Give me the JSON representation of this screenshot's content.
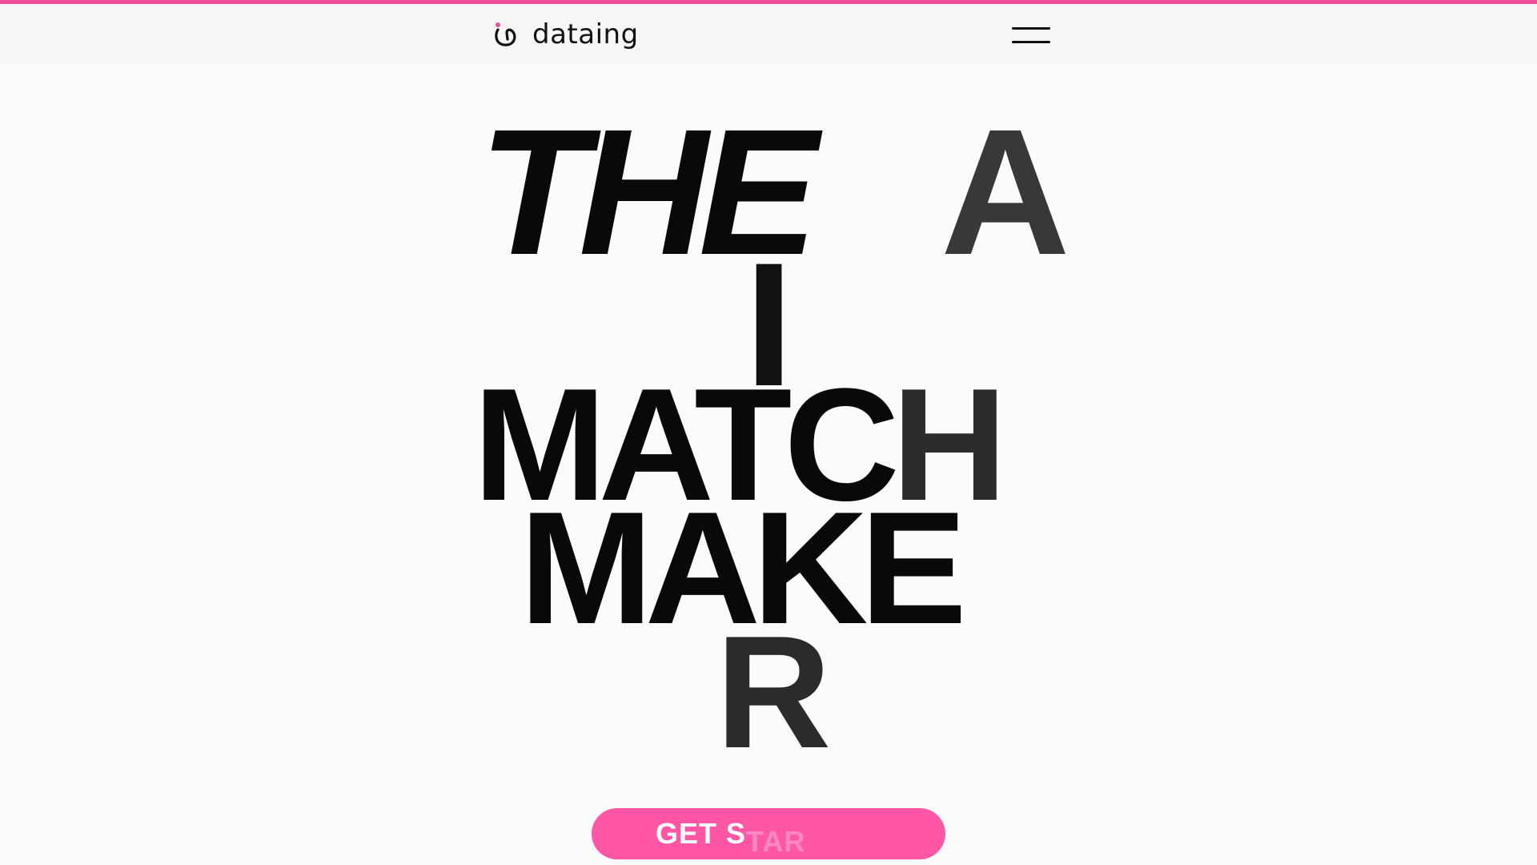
{
  "header": {
    "logo_text": "dataing",
    "logo_icon": "heart-loop-icon",
    "menu_icon": "hamburger-menu-icon"
  },
  "hero": {
    "line1": "THE",
    "line1_letter": "A",
    "line2": "I",
    "line3_main": "MATC",
    "line3_end": "H",
    "line4": "MAKE",
    "line5": "R"
  },
  "cta": {
    "label_visible": "GET S",
    "label_fading": "TAR",
    "background": "#ff56a6",
    "text_color": "#ffffff"
  },
  "colors": {
    "accent": "#ee4d9a",
    "header_bg": "#f7f6f4",
    "page_bg": "#fbfbfb",
    "text": "#080909"
  }
}
